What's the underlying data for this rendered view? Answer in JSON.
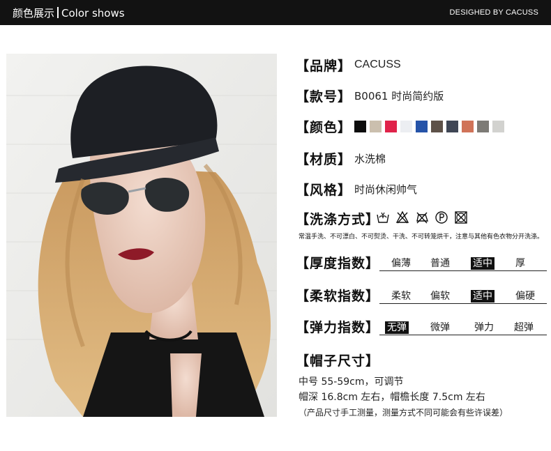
{
  "header": {
    "left_cn": "颜色展示",
    "left_en": "Color shows",
    "right": "DESIGHED BY CACUSS"
  },
  "specs": {
    "brand": {
      "label": "【品牌】",
      "value": "CACUSS"
    },
    "model": {
      "label": "【款号】",
      "value": "B0061 时尚简约版"
    },
    "color": {
      "label": "【颜色】",
      "swatches": [
        "#0d0d0d",
        "#cbbfae",
        "#e0234a",
        "#eceef2",
        "#2553a8",
        "#5e5249",
        "#3f4655",
        "#d07358",
        "#7d7b76",
        "#d2d2cf"
      ]
    },
    "material": {
      "label": "【材质】",
      "value": "水洗棉"
    },
    "style": {
      "label": "【风格】",
      "value": "时尚休闲帅气"
    },
    "wash": {
      "label": "【洗涤方式】",
      "icons": [
        "hand-wash-icon",
        "no-bleach-icon",
        "no-iron-icon",
        "dry-clean-p-icon",
        "no-tumble-dry-icon"
      ],
      "note": "常温手洗、不可漂白、不可熨烫、干洗、不可转笼烘干，注意与其他有色衣物分开洗涤。"
    },
    "thickness": {
      "label": "【厚度指数】",
      "options": [
        "偏薄",
        "普通",
        "适中",
        "厚"
      ],
      "selected": 2
    },
    "softness": {
      "label": "【柔软指数】",
      "options": [
        "柔软",
        "偏软",
        "适中",
        "偏硬"
      ],
      "selected": 2
    },
    "elasticity": {
      "label": "【弹力指数】",
      "options": [
        "无弹",
        "微弹",
        "弹力",
        "超弹"
      ],
      "selected": 0
    },
    "size": {
      "label": "【帽子尺寸】",
      "line1": "中号 55-59cm，可调节",
      "line2": "帽深 16.8cm 左右，帽檐长度 7.5cm 左右",
      "note": "（产品尺寸手工测量，测量方式不同可能会有些许误差）"
    }
  }
}
